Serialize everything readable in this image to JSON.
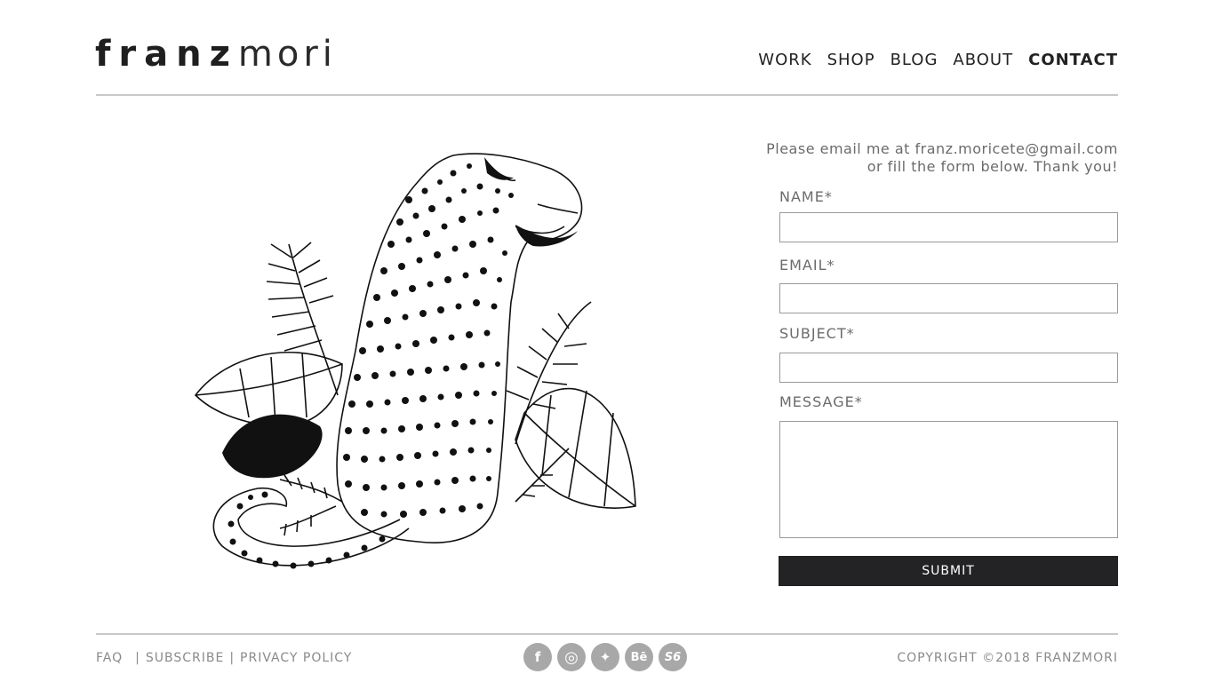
{
  "brand": {
    "bold": "franz",
    "light": "mori"
  },
  "nav": [
    {
      "label": "WORK",
      "active": false
    },
    {
      "label": "SHOP",
      "active": false
    },
    {
      "label": "BLOG",
      "active": false
    },
    {
      "label": "ABOUT",
      "active": false
    },
    {
      "label": "CONTACT",
      "active": true
    }
  ],
  "contact": {
    "intro_line1": "Please email me at franz.moricete@gmail.com",
    "intro_line2": "or fill the form below. Thank you!",
    "name_label": "NAME*",
    "email_label": "EMAIL*",
    "subject_label": "SUBJECT*",
    "message_label": "MESSAGE*",
    "name_value": "",
    "email_value": "",
    "subject_value": "",
    "message_value": "",
    "submit_label": "SUBMIT"
  },
  "footer": {
    "links": [
      "FAQ",
      "SUBSCRIBE",
      "PRIVACY POLICY"
    ],
    "social": [
      {
        "name": "facebook-icon",
        "glyph": "f"
      },
      {
        "name": "instagram-icon",
        "glyph": "◎"
      },
      {
        "name": "twitter-icon",
        "glyph": "✦"
      },
      {
        "name": "behance-icon",
        "glyph": "Bē"
      },
      {
        "name": "society6-icon",
        "glyph": "S6"
      }
    ],
    "copyright": "COPYRIGHT ©2018 FRANZMORI"
  },
  "colors": {
    "text": "#222222",
    "muted": "#8a8a8a",
    "button": "#232326",
    "icon": "#a8a8a8"
  }
}
